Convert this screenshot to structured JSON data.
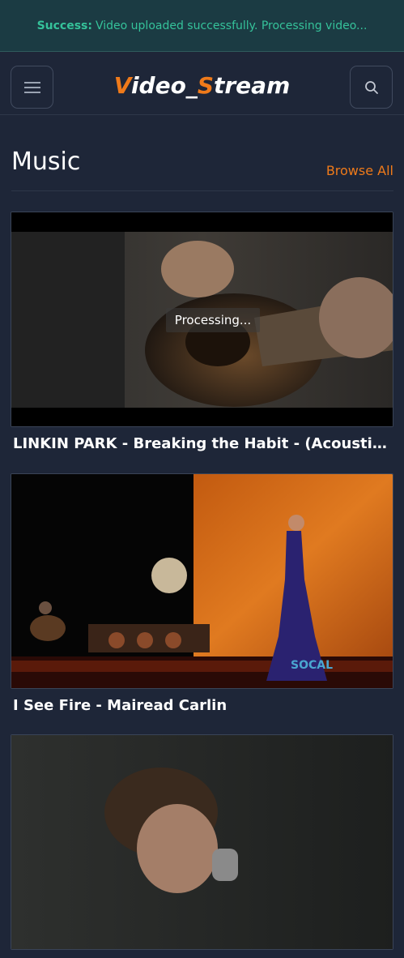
{
  "toast": {
    "label": "Success:",
    "message": "Video uploaded successfully. Processing video..."
  },
  "header": {
    "brand_first_initial": "V",
    "brand_first_rest": "ideo_",
    "brand_second_initial": "S",
    "brand_second_rest": "tream",
    "menu_icon": "hamburger-menu-icon",
    "search_icon": "search-icon"
  },
  "section": {
    "title": "Music",
    "browse_label": "Browse All"
  },
  "videos": [
    {
      "title": "LINKIN PARK - Breaking the Habit - (Acoustic cover)",
      "overlay": "Processing..."
    },
    {
      "title": "I See Fire - Mairead Carlin"
    },
    {
      "title": ""
    }
  ],
  "colors": {
    "accent": "#ef7a1a",
    "success": "#35c29a",
    "background": "#1e2638"
  }
}
